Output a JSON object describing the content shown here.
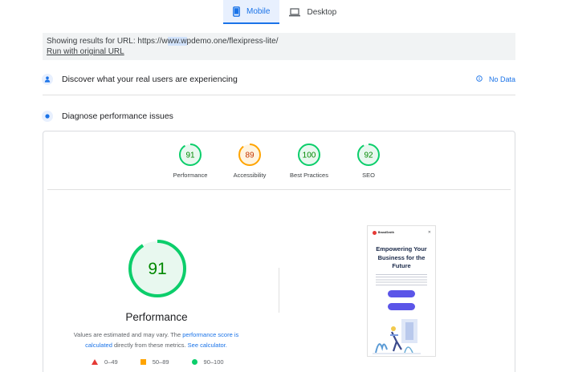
{
  "tabs": [
    {
      "label": "Mobile",
      "icon": "smartphone-icon",
      "active": true
    },
    {
      "label": "Desktop",
      "icon": "laptop-icon",
      "active": false
    }
  ],
  "url_box": {
    "prefix": "Showing results for URL: https://w",
    "highlight": "ww.w",
    "suffix": "pdemo.one/flexipress-lite/",
    "link": "Run with original URL"
  },
  "sections": {
    "discover": {
      "label": "Discover what your real users are experiencing",
      "status": "No Data"
    },
    "diagnose": {
      "label": "Diagnose performance issues"
    }
  },
  "scores": [
    {
      "label": "Performance",
      "value": 91,
      "color": "#0cce6b",
      "bg": "#e8f8ef"
    },
    {
      "label": "Accessibility",
      "value": 89,
      "color": "#ffa400",
      "bg": "#fff4e0"
    },
    {
      "label": "Best Practices",
      "value": 100,
      "color": "#0cce6b",
      "bg": "#e8f8ef"
    },
    {
      "label": "SEO",
      "value": 92,
      "color": "#0cce6b",
      "bg": "#e8f8ef"
    }
  ],
  "main_score": {
    "label": "Performance",
    "value": 91,
    "color": "#0cce6b"
  },
  "note": {
    "text1": "Values are estimated and may vary. The ",
    "link1": "performance score is calculated",
    "text2": " directly from these metrics. ",
    "link2": "See calculator."
  },
  "legend": [
    {
      "range": "0–49",
      "shape": "triangle",
      "color": "#e53935"
    },
    {
      "range": "50–89",
      "shape": "square",
      "color": "#ffa400"
    },
    {
      "range": "90–100",
      "shape": "circle",
      "color": "#0cce6b"
    }
  ],
  "preview": {
    "brand": "BrandSmith",
    "headline": "Empowering Your Business for the Future"
  }
}
